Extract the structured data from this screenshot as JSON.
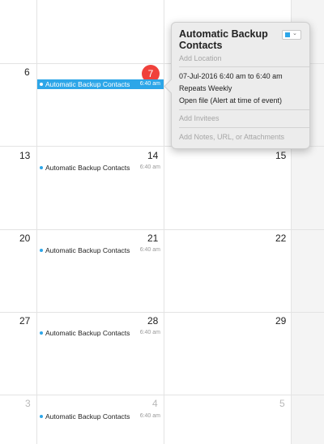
{
  "calendar": {
    "weeks": [
      {
        "days": [
          {
            "num": "",
            "dim": false
          },
          {
            "num": "",
            "dim": false
          },
          {
            "num": "",
            "dim": false
          }
        ]
      },
      {
        "days": [
          {
            "num": "6",
            "dim": false
          },
          {
            "num": "7",
            "today": true
          },
          {
            "num": "",
            "dim": false
          }
        ],
        "event": {
          "title": "Automatic Backup Contacts",
          "time": "6:40 am",
          "selected": true
        }
      },
      {
        "days": [
          {
            "num": "13",
            "dim": false
          },
          {
            "num": "14",
            "dim": false
          },
          {
            "num": "15",
            "dim": false
          }
        ],
        "event": {
          "title": "Automatic Backup Contacts",
          "time": "6:40 am",
          "selected": false
        }
      },
      {
        "days": [
          {
            "num": "20",
            "dim": false
          },
          {
            "num": "21",
            "dim": false
          },
          {
            "num": "22",
            "dim": false
          }
        ],
        "event": {
          "title": "Automatic Backup Contacts",
          "time": "6:40 am",
          "selected": false
        }
      },
      {
        "days": [
          {
            "num": "27",
            "dim": false
          },
          {
            "num": "28",
            "dim": false
          },
          {
            "num": "29",
            "dim": false
          }
        ],
        "event": {
          "title": "Automatic Backup Contacts",
          "time": "6:40 am",
          "selected": false
        }
      },
      {
        "days": [
          {
            "num": "3",
            "dim": true
          },
          {
            "num": "4",
            "dim": true
          },
          {
            "num": "5",
            "dim": true
          }
        ],
        "event": {
          "title": "Automatic Backup Contacts",
          "time": "6:40 am",
          "selected": false
        }
      }
    ]
  },
  "popover": {
    "title": "Automatic Backup Contacts",
    "location_placeholder": "Add Location",
    "datetime": "07-Jul-2016  6:40 am to 6:40 am",
    "repeat": "Repeats Weekly",
    "alert": "Open file (Alert at time of event)",
    "invitees_placeholder": "Add Invitees",
    "notes_placeholder": "Add Notes, URL, or Attachments",
    "calendar_color": "#2da6e8",
    "color_picker_icon": "chevron-down-icon"
  },
  "colors": {
    "event_blue": "#2da6e8",
    "today_red": "#f0413b"
  }
}
